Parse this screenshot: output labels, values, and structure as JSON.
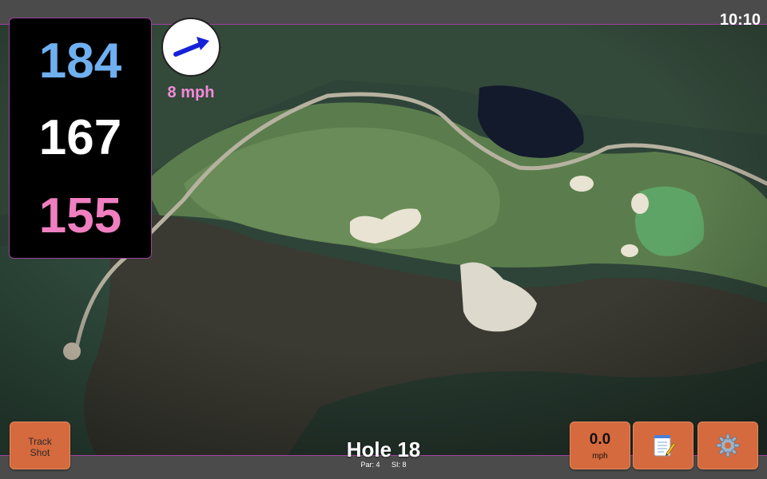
{
  "status_bar": {
    "time": "10:10"
  },
  "distances": {
    "back": "184",
    "middle": "167",
    "front": "155"
  },
  "wind": {
    "speed_label": "8 mph",
    "arrow_icon": "wind-direction-arrow-icon"
  },
  "buttons": {
    "track_shot_line1": "Track",
    "track_shot_line2": "Shot",
    "speed_value": "0.0",
    "speed_unit": "mph",
    "notes_icon": "notepad-icon",
    "settings_icon": "gear-icon"
  },
  "hole": {
    "title": "Hole 18",
    "par": "Par: 4",
    "si": "SI: 8"
  },
  "colors": {
    "back_distance": "#6fb0f0",
    "middle_distance": "#ffffff",
    "front_distance": "#f07fc0",
    "wind_speed": "#f28ad8",
    "button": "#d56a3e",
    "accent_border": "#a040a0"
  }
}
